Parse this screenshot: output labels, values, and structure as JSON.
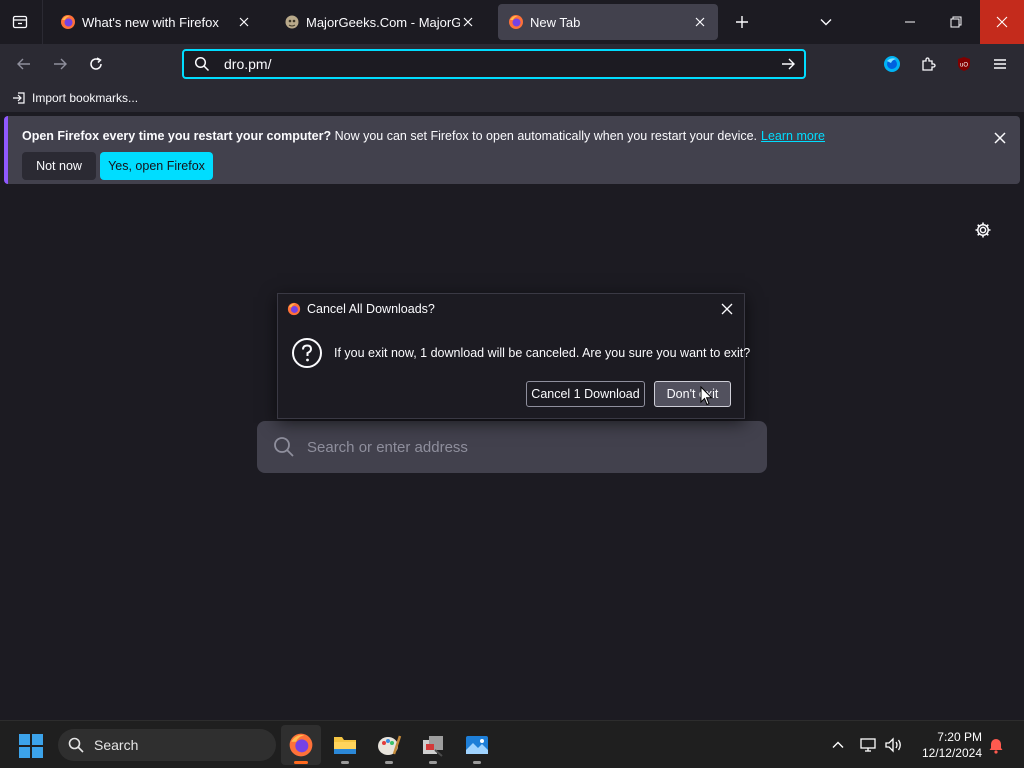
{
  "tabs": [
    {
      "title": "What's new with Firefox",
      "favicon": "firefox-icon",
      "active": false
    },
    {
      "title": "MajorGeeks.Com - MajorGeeks",
      "favicon": "majorgeeks-icon",
      "active": false
    },
    {
      "title": "New Tab",
      "favicon": "firefox-icon",
      "active": true
    }
  ],
  "navbar": {
    "url": "dro.pm/"
  },
  "bookmarks": {
    "import_label": "Import bookmarks..."
  },
  "banner": {
    "bold_text": "Open Firefox every time you restart your computer?",
    "text": " Now you can set Firefox to open automatically when you restart your device.",
    "link": "Learn more",
    "not_now": "Not now",
    "yes": "Yes, open Firefox"
  },
  "newtab": {
    "search_placeholder": "Search or enter address"
  },
  "dialog": {
    "title": "Cancel All Downloads?",
    "message": "If you exit now, 1 download will be canceled. Are you sure you want to exit?",
    "cancel_btn": "Cancel 1 Download",
    "dont_exit_btn": "Don't exit"
  },
  "taskbar": {
    "search_label": "Search",
    "apps": [
      "firefox-icon",
      "file-explorer-icon",
      "paint-icon",
      "installer-icon",
      "photos-icon"
    ],
    "time": "7:20 PM",
    "date": "12/12/2024"
  },
  "colors": {
    "accent": "#00ddff",
    "close_red": "#c42b1c",
    "banner_bar": "#9059ff"
  }
}
